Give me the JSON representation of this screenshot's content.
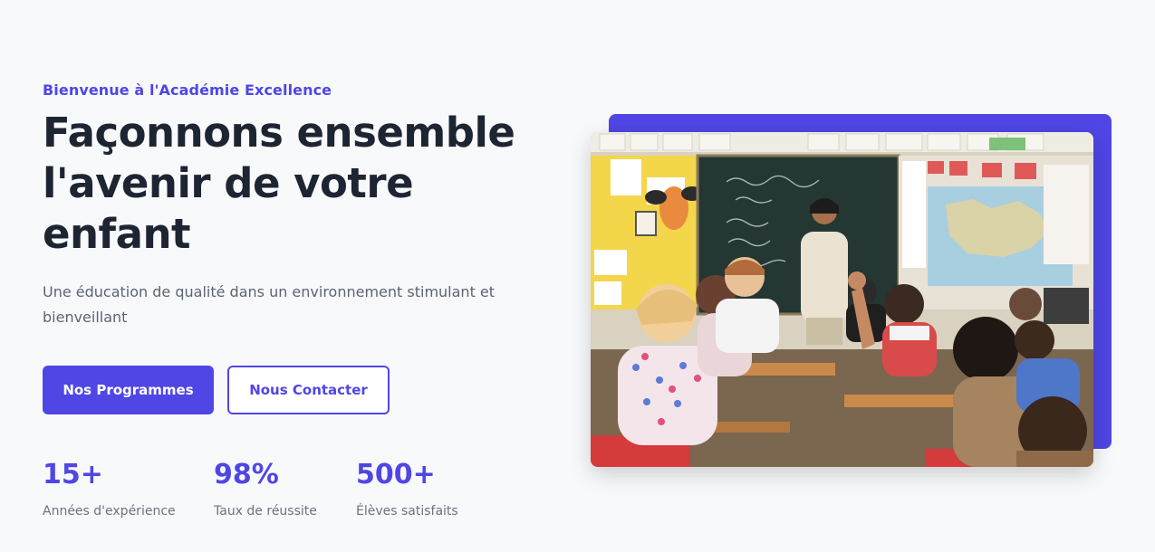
{
  "hero": {
    "eyebrow": "Bienvenue à l'Académie Excellence",
    "title": "Façonnons ensemble l'avenir de votre enfant",
    "subtitle": "Une éducation de qualité dans un environnement stimulant et bienveillant",
    "buttons": {
      "primary_label": "Nos Programmes",
      "secondary_label": "Nous Contacter"
    },
    "stats": [
      {
        "value": "15+",
        "label": "Années d'expérience"
      },
      {
        "value": "98%",
        "label": "Taux de réussite"
      },
      {
        "value": "500+",
        "label": "Élèves satisfaits"
      }
    ]
  },
  "image": {
    "alt": "Salle de classe avec une enseignante au tableau et des élèves"
  },
  "colors": {
    "accent": "#4f46e5",
    "background": "#f8f9fb",
    "heading": "#1e2532",
    "muted": "#6b7280"
  }
}
